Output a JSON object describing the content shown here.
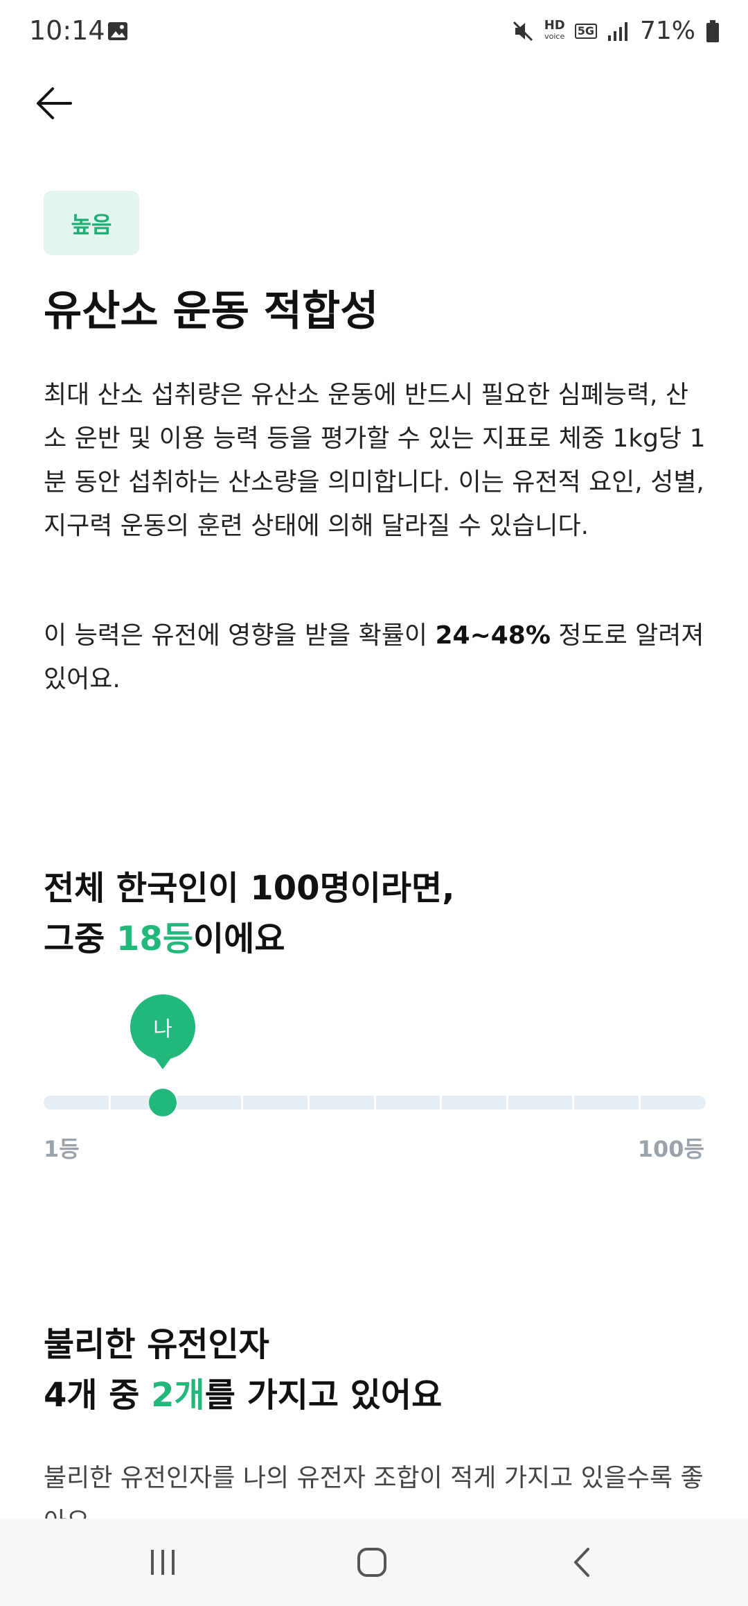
{
  "status_bar": {
    "time": "10:14",
    "hd_label": "HD",
    "hd_sub": "voice",
    "net_label": "5G",
    "battery": "71%"
  },
  "icons": {
    "back": "back-arrow-icon",
    "gallery": "image-icon",
    "mute": "mute-icon",
    "signal": "signal-icon",
    "battery": "battery-icon"
  },
  "badge": "높음",
  "title": "유산소 운동 적합성",
  "description": "최대 산소 섭취량은 유산소 운동에 반드시 필요한 심폐능력, 산소 운반 및 이용 능력 등을 평가할 수 있는 지표로 체중 1kg당 1분 동안 섭취하는 산소량을 의미합니다. 이는 유전적 요인, 성별, 지구력 운동의 훈련 상태에 의해 달라질 수 있습니다.",
  "heritability": {
    "prefix": "이 능력은 유전에 영향을 받을 확률이 ",
    "value": "24~48%",
    "suffix": " 정도로 알려져 있어요."
  },
  "rank": {
    "line1": "전체 한국인이 100명이라면,",
    "line2_prefix": "그중 ",
    "line2_highlight": "18등",
    "line2_suffix": "이에요",
    "pin_label": "나",
    "min_label": "1등",
    "max_label": "100등",
    "position": 18
  },
  "genes": {
    "line1": "불리한 유전인자",
    "line2_prefix": "4개 중 ",
    "line2_highlight": "2개",
    "line2_suffix": "를 가지고 있어요",
    "description": "불리한 유전인자를 나의 유전자 조합이 적게 가지고 있을수록 좋아요."
  },
  "colors": {
    "accent": "#22b87c",
    "badge_bg": "#e2f6ee",
    "track": "#e6edf3"
  }
}
